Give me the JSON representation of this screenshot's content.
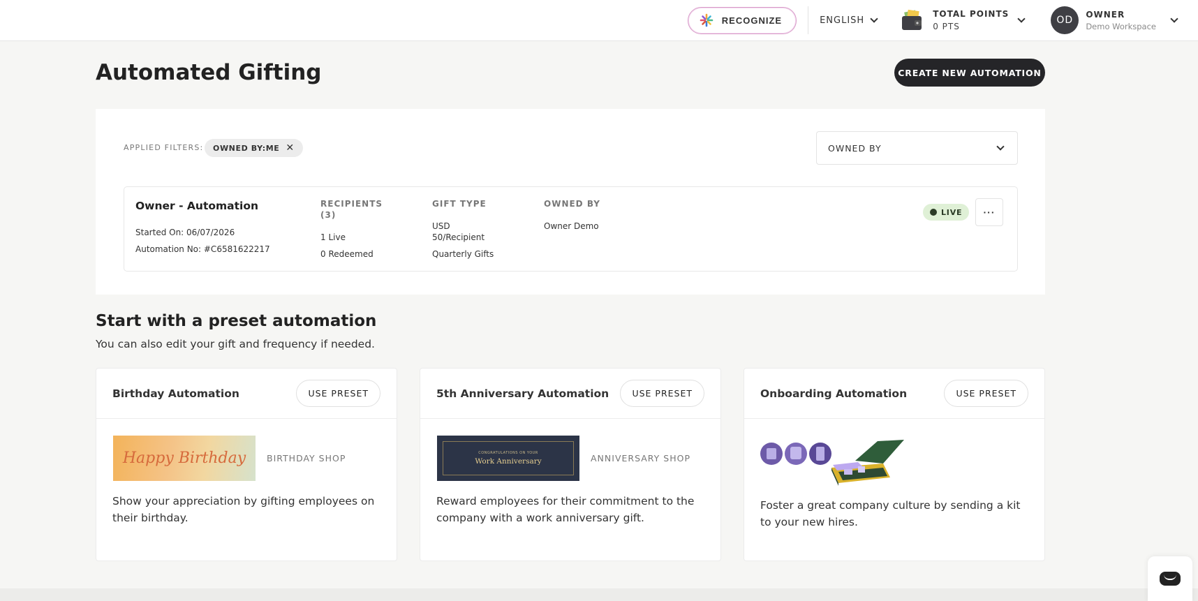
{
  "topbar": {
    "recognize_label": "RECOGNIZE",
    "language": "ENGLISH",
    "points_title": "TOTAL POINTS",
    "points_value": "0 PTS",
    "user_initials": "OD",
    "user_name": "OWNER",
    "workspace": "Demo Workspace"
  },
  "page": {
    "title": "Automated Gifting",
    "create_label": "CREATE NEW AUTOMATION"
  },
  "filters": {
    "label": "APPLIED FILTERS:",
    "chip": "OWNED BY:ME",
    "owned_by_select": "OWNED BY"
  },
  "automation": {
    "name": "Owner - Automation",
    "started": "Started On: 06/07/2026",
    "number": "Automation No: #C6581622217",
    "recipients_header": "RECIPIENTS",
    "recipients_count": "(3)",
    "live_count": "1 Live",
    "redeemed_count": "0 Redeemed",
    "gift_type_header": "GIFT TYPE",
    "gift_currency": "USD",
    "gift_amount": "50/Recipient",
    "gift_name": "Quarterly Gifts",
    "owned_by_header": "OWNED BY",
    "owner": "Owner Demo",
    "status": "LIVE",
    "more": "···"
  },
  "presets": {
    "title": "Start with a preset automation",
    "subtitle": "You can also edit your gift and frequency if needed.",
    "cards": [
      {
        "title": "Birthday Automation",
        "button": "USE PRESET",
        "image_text": "Happy Birthday",
        "shop": "BIRTHDAY SHOP",
        "description": "Show your appreciation by gifting employees on their birthday."
      },
      {
        "title": "5th Anniversary Automation",
        "button": "USE PRESET",
        "image_small": "CONGRATULATIONS ON YOUR",
        "image_text": "Work Anniversary",
        "shop": "ANNIVERSARY SHOP",
        "description": "Reward employees for their commitment to the company with a work anniversary gift."
      },
      {
        "title": "Onboarding Automation",
        "button": "USE PRESET",
        "description": "Foster a great company culture by sending a kit to your new hires."
      }
    ]
  },
  "colors": {
    "primary_dark": "#252528",
    "live_bg": "#dff0d6",
    "background": "#f6f6f4"
  }
}
